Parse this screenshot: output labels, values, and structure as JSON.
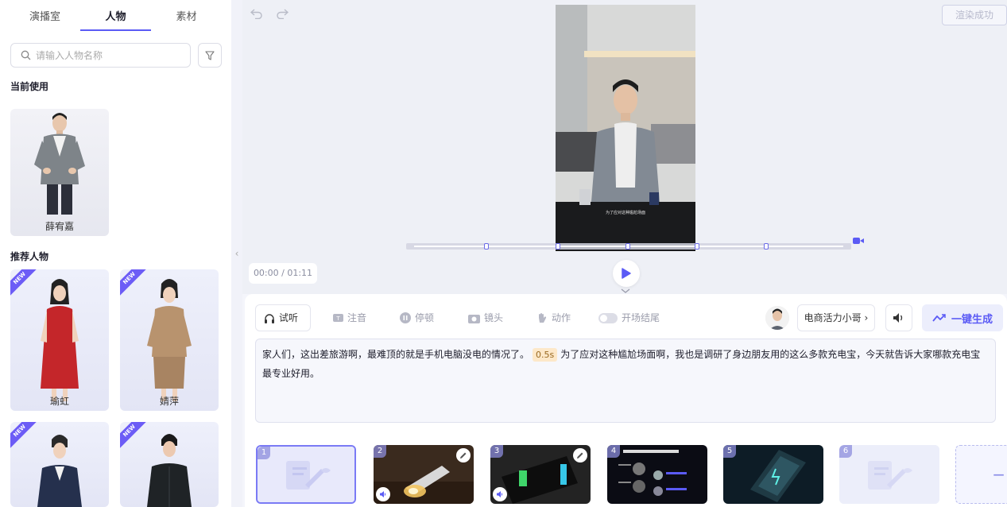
{
  "left_panel": {
    "tabs": [
      "演播室",
      "人物",
      "素材"
    ],
    "active_tab": "人物",
    "search_placeholder": "请输入人物名称",
    "current_section": "当前使用",
    "current_person": "薛宥嘉",
    "recommended_section": "推荐人物",
    "new_badge": "NEW",
    "recommended": [
      {
        "name": "瑜虹",
        "is_new": true
      },
      {
        "name": "婧萍",
        "is_new": true
      },
      {
        "name": "",
        "is_new": true
      },
      {
        "name": "",
        "is_new": true
      }
    ]
  },
  "preview": {
    "render_status": "渲染成功",
    "time_display": "00:00 / 01:11",
    "video_subtitle": "为了应对这种尴尬场面"
  },
  "toolbar": {
    "listen": "试听",
    "note": "注音",
    "pause": "停顿",
    "camera": "镜头",
    "action": "动作",
    "opening_ending": "开场结尾",
    "voice": "电商活力小哥",
    "generate": "一键生成"
  },
  "script": {
    "part1": "家人们，这出差旅游啊，最难顶的就是手机电脑没电的情况了。",
    "pause_tag": "0.5s",
    "part2": "为了应对这种尴尬场面啊，我也是调研了身边朋友用的这么多款充电宝，今天就告诉大家哪款充电宝最专业好用。"
  },
  "scenes": [
    {
      "num": "1",
      "selected": true
    },
    {
      "num": "2"
    },
    {
      "num": "3"
    },
    {
      "num": "4"
    },
    {
      "num": "5"
    },
    {
      "num": "6"
    }
  ],
  "colors": {
    "accent": "#5b5bf5",
    "new_badge": "#6c5cf6",
    "pause_tag_bg": "#fde8c9"
  }
}
